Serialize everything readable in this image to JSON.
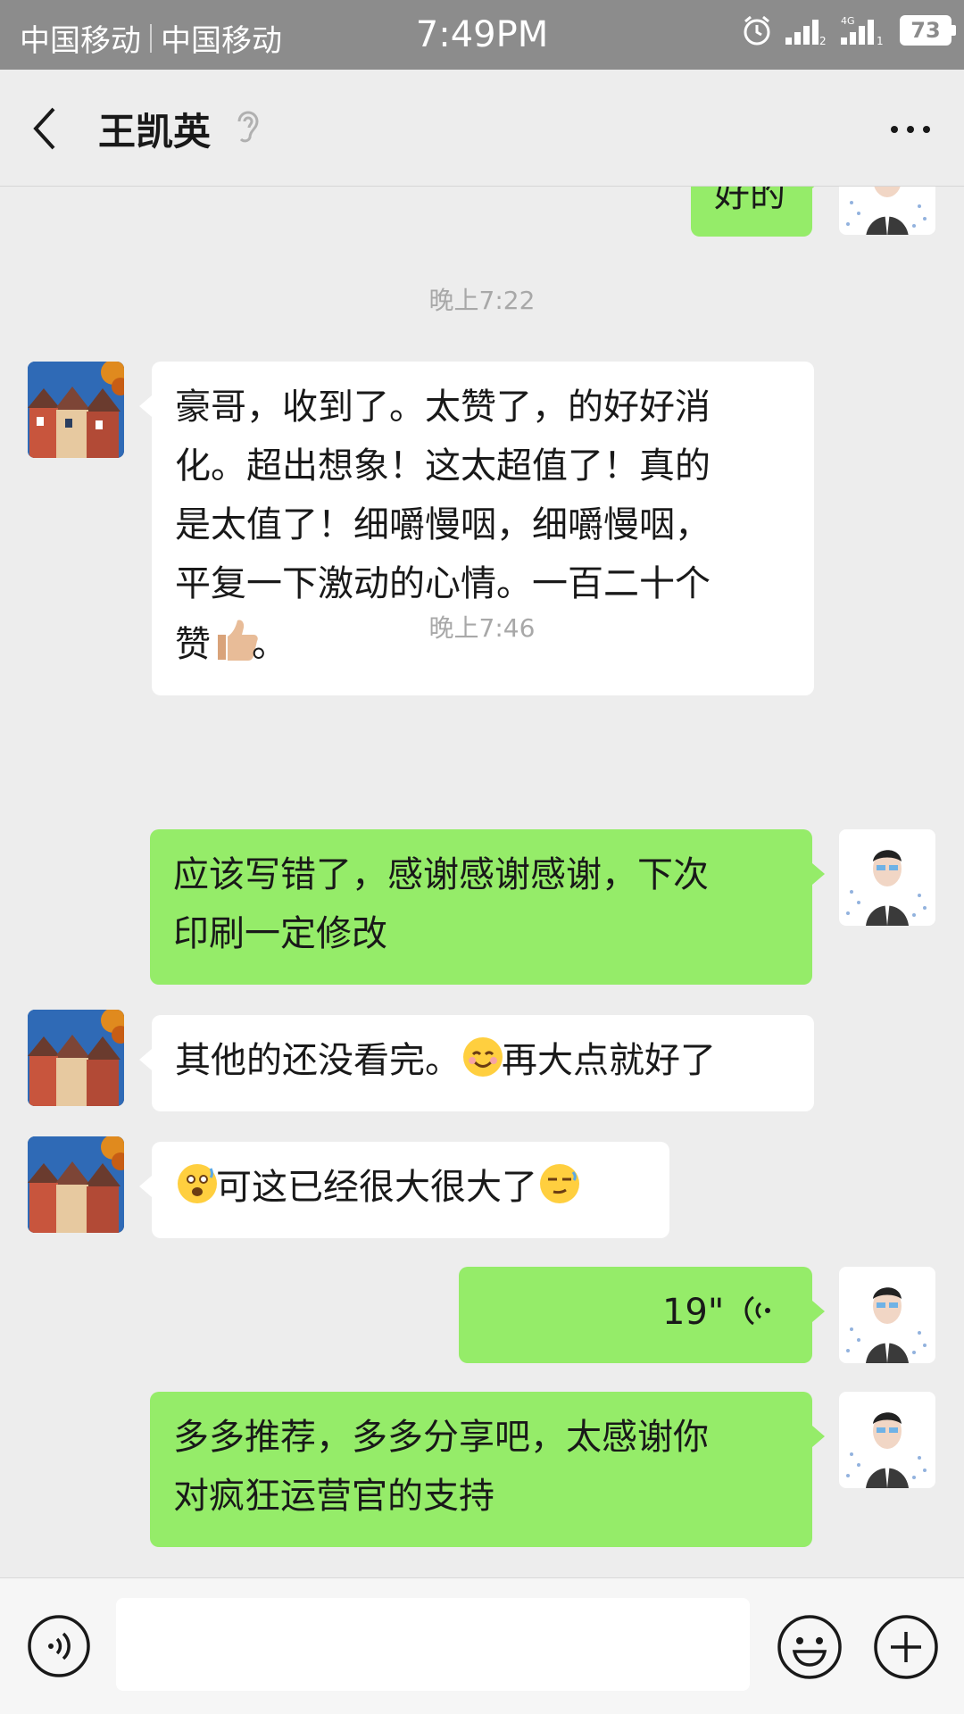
{
  "status_bar": {
    "carrier1": "中国移动",
    "carrier2": "中国移动",
    "time": "7:49PM",
    "network": "4G",
    "battery": "73"
  },
  "header": {
    "title": "王凯英",
    "icon_ear": "ear-icon",
    "icon_more": "more-icon",
    "icon_back": "back-icon"
  },
  "messages": {
    "top_partial": "好的",
    "ts1": "晚上7:22",
    "m1": "豪哥，收到了。太赞了，的好好消化。超出想象！这太超值了！真的是太值了！细嚼慢咽，细嚼慢咽，平复一下激动的心情。一百二十个赞👍🏼。",
    "m1_line1": "豪哥，收到了。太赞了，的好好消",
    "m1_line2": "化。超出想象！这太超值了！真的",
    "m1_line3": "是太值了！细嚼慢咽，细嚼慢咽，",
    "m1_line4": "平复一下激动的心情。一百二十个",
    "m1_line5a": "赞",
    "m1_line5b": "。",
    "ts2": "晚上7:46",
    "m2_line1": "应该写错了，感谢感谢感谢，下次",
    "m2_line2": "印刷一定修改",
    "m3a": "其他的还没看完。",
    "m3b": "再大点就好了",
    "m4": "可这已经很大很大了",
    "voice_duration": "19\"",
    "m6_line1": "多多推荐，多多分享吧，太感谢你",
    "m6_line2": "对疯狂运营官的支持"
  },
  "colors": {
    "sent_bubble": "#95ec69",
    "received_bubble": "#ffffff",
    "background": "#ededed",
    "status_bar": "#8c8c8c"
  }
}
